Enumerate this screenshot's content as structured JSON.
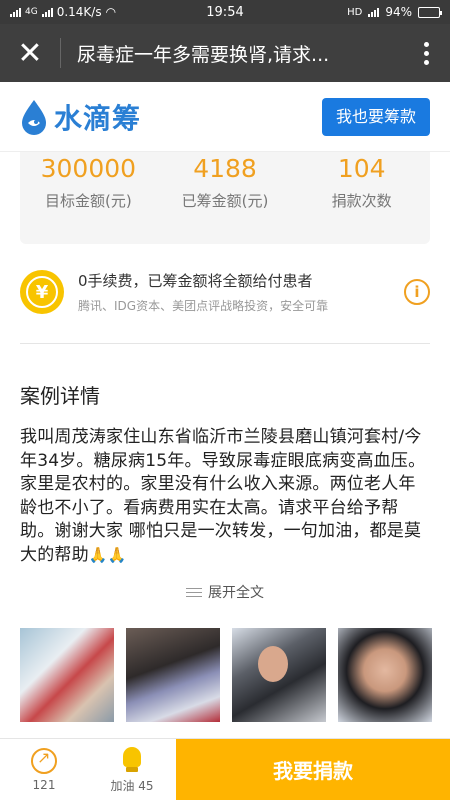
{
  "status_bar": {
    "carrier": "4G",
    "speed": "0.14K/s",
    "time": "19:54",
    "battery": "94%"
  },
  "title_bar": {
    "title": "尿毒症一年多需要换肾,请求..."
  },
  "brand": {
    "name": "水滴筹",
    "start_button": "我也要筹款",
    "accent": "#1a7ae0"
  },
  "stats": [
    {
      "value": "300000",
      "label": "目标金额(元)"
    },
    {
      "value": "4188",
      "label": "已筹金额(元)"
    },
    {
      "value": "104",
      "label": "捐款次数"
    }
  ],
  "fee": {
    "icon": "¥",
    "main": "0手续费，已筹金额将全额给付患者",
    "sub": "腾讯、IDG资本、美团点评战略投资，安全可靠",
    "info_icon": "i"
  },
  "case": {
    "title": "案例详情",
    "body": "我叫周茂涛家住山东省临沂市兰陵县磨山镇河套村/今年34岁。糖尿病15年。导致尿毒症眼底病变高血压。家里是农村的。家里没有什么收入来源。两位老人年龄也不小了。看病费用实在太高。请求平台给予帮助。谢谢大家 哪怕只是一次转发，一句加油，都是莫大的帮助",
    "emoji": "🙏🙏",
    "expand_label": "展开全文"
  },
  "bottom_bar": {
    "share_count": "121",
    "cheer_label": "加油 45",
    "donate_button": "我要捐款",
    "donate_color": "#ffb400"
  }
}
